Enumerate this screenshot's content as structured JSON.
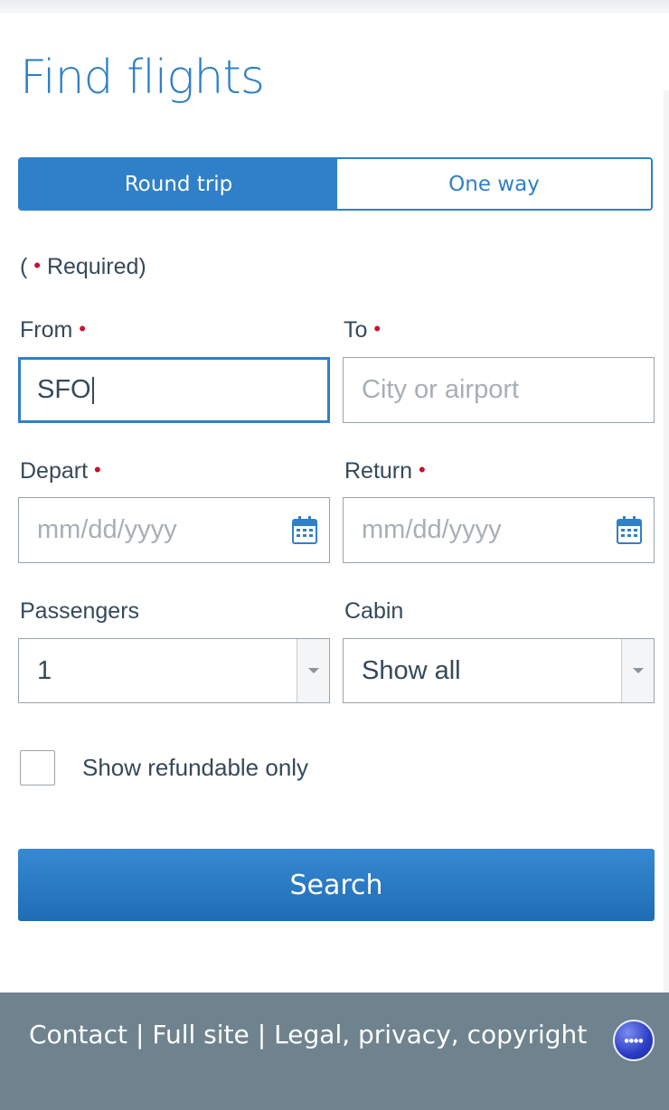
{
  "page": {
    "title": "Find flights"
  },
  "trip_toggle": {
    "round_trip": "Round trip",
    "one_way": "One way"
  },
  "required_note": {
    "open": "(",
    "text": "Required)"
  },
  "from": {
    "label": "From",
    "value": "SFO"
  },
  "to": {
    "label": "To",
    "placeholder": "City or airport"
  },
  "depart": {
    "label": "Depart",
    "placeholder": "mm/dd/yyyy"
  },
  "return": {
    "label": "Return",
    "placeholder": "mm/dd/yyyy"
  },
  "passengers": {
    "label": "Passengers",
    "value": "1"
  },
  "cabin": {
    "label": "Cabin",
    "value": "Show all"
  },
  "refundable": {
    "label": "Show refundable only",
    "checked": false
  },
  "search": {
    "label": "Search"
  },
  "footer": {
    "contact": "Contact",
    "full_site": "Full site",
    "legal": "Legal, privacy, copyright",
    "separator": "|"
  },
  "colors": {
    "accent": "#2f80c8",
    "required": "#c8102e",
    "footer_bg": "#6f838f"
  },
  "icons": {
    "calendar": "calendar-icon",
    "dropdown": "chevron-down-icon",
    "badge": "site-badge-icon"
  }
}
